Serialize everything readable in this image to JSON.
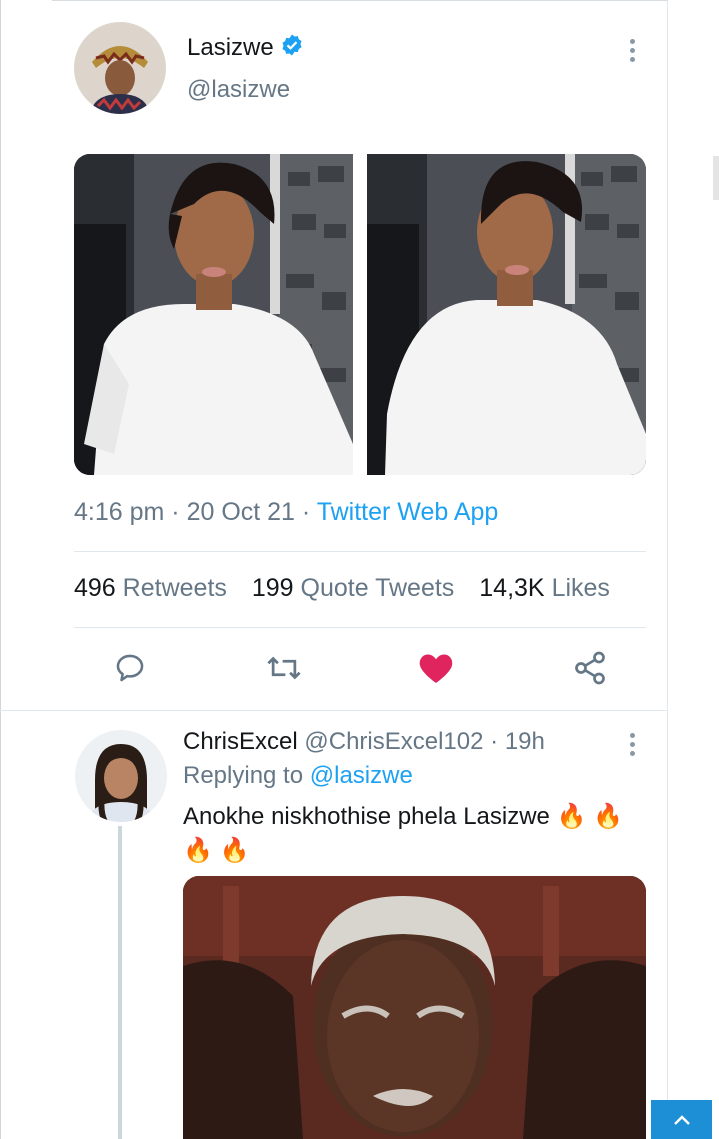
{
  "tweet": {
    "author": {
      "name": "Lasizwe",
      "handle": "@lasizwe",
      "verified": true
    },
    "timestamp": {
      "time": "4:16 pm",
      "sep1": " · ",
      "date": "20 Oct 21",
      "sep2": " · ",
      "source": "Twitter Web App"
    },
    "stats": {
      "retweets": {
        "count": "496",
        "label": "Retweets"
      },
      "quotes": {
        "count": "199",
        "label": "Quote Tweets"
      },
      "likes": {
        "count": "14,3K",
        "label": "Likes"
      }
    },
    "actions": [
      "reply-icon",
      "retweet-icon",
      "like-icon",
      "share-icon"
    ],
    "liked": true
  },
  "reply": {
    "name": "ChrisExcel",
    "handle": "@ChrisExcel102",
    "sep": " · ",
    "age": "19h",
    "replying_prefix": "Replying to ",
    "replying_handle": "@lasizwe",
    "text": "Anokhe niskhothise phela Lasizwe",
    "emoji_line1": "🔥 🔥",
    "emoji_line2": "🔥 🔥"
  },
  "colors": {
    "accent": "#1da1f2",
    "like": "#e0245e",
    "muted": "#657786"
  }
}
